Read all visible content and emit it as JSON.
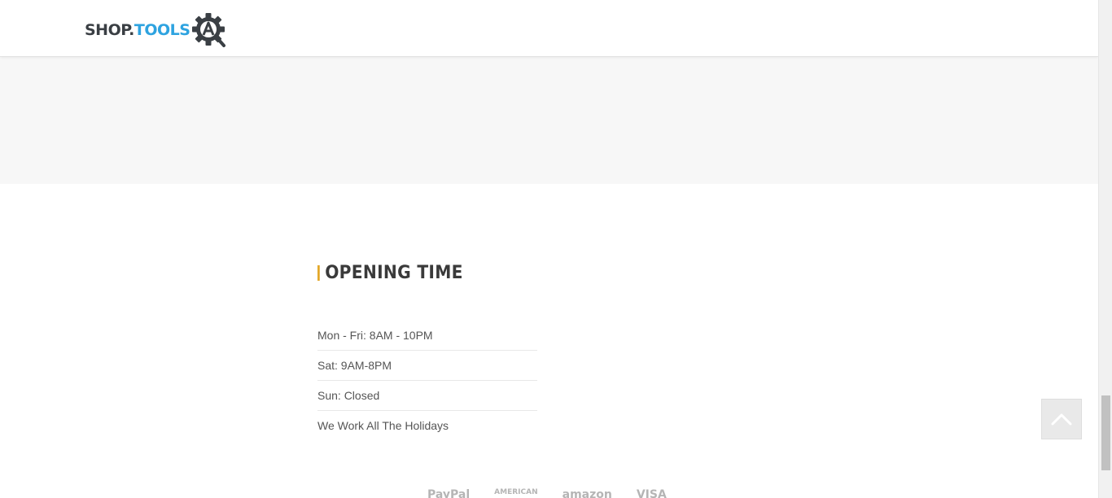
{
  "header": {
    "logo": {
      "text_primary": "SHOP.",
      "text_accent": "TOOLS",
      "icon": "gear-a-icon",
      "colors": {
        "primary": "#3a3f44",
        "accent": "#2ea3e0"
      }
    }
  },
  "opening_time": {
    "title": "OPENING TIME",
    "accent_color": "#e3a82a",
    "hours": [
      "Mon - Fri: 8AM - 10PM",
      "Sat: 9AM-8PM",
      "Sun: Closed",
      "We Work All The Holidays"
    ]
  },
  "payments": {
    "items": [
      "PayPal",
      "AMERICAN",
      "amazon",
      "VISA"
    ]
  },
  "back_to_top": {
    "icon": "chevron-up-icon"
  }
}
